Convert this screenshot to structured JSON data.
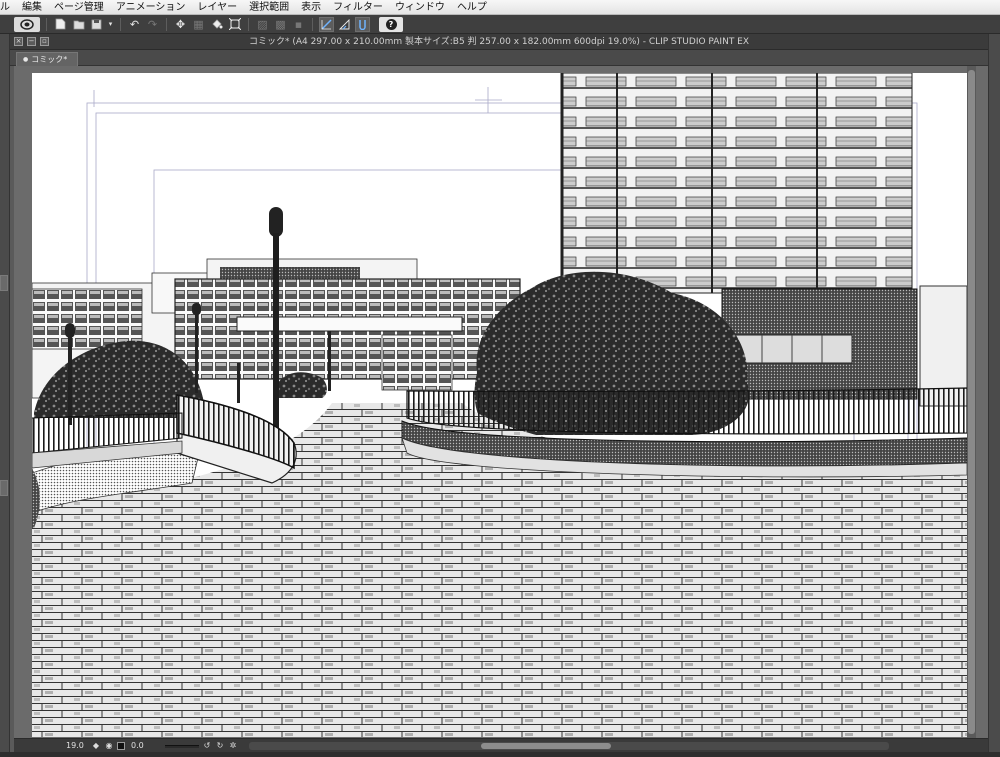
{
  "menu": {
    "items": [
      "ル",
      "編集",
      "ページ管理",
      "アニメーション",
      "レイヤー",
      "選択範囲",
      "表示",
      "フィルター",
      "ウィンドウ",
      "ヘルプ"
    ]
  },
  "window": {
    "title": "コミック* (A4 297.00 x 210.00mm 製本サイズ:B5 判 257.00 x 182.00mm 600dpi 19.0%)  - CLIP STUDIO PAINT EX"
  },
  "tab": {
    "label": "コミック*"
  },
  "status": {
    "zoom": "19.0",
    "angle": "0.0"
  },
  "icons": {
    "toolbar": [
      "clip-studio-logo-icon",
      "new-document-icon",
      "open-folder-icon",
      "save-icon",
      "undo-icon",
      "redo-icon",
      "transform-icon",
      "selection-icon",
      "fill-icon",
      "crop-icon",
      "ruler-icon",
      "pen-snap-icon",
      "help-icon"
    ]
  },
  "colors": {
    "menubar": "#ececec",
    "toolbar": "#3f3f3f",
    "canvas_bg": "#6b6b6b",
    "paper": "#ffffff"
  }
}
